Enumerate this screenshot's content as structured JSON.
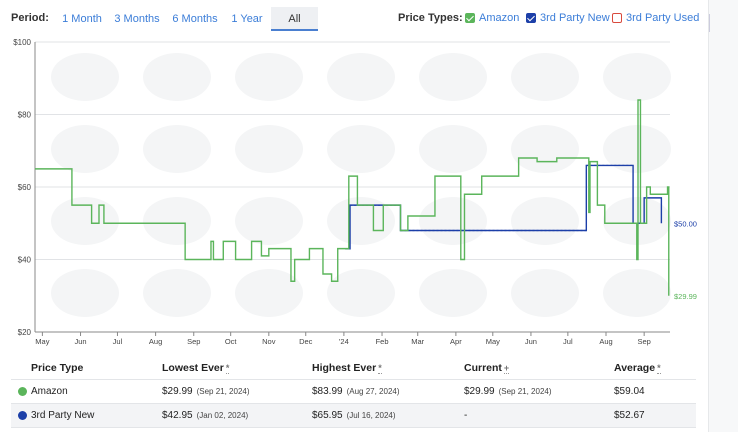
{
  "toolbar": {
    "period_label": "Period:",
    "periods": [
      "1 Month",
      "3 Months",
      "6 Months",
      "1 Year",
      "All"
    ],
    "active_period": "All",
    "price_types_label": "Price Types:",
    "price_types": [
      {
        "label": "Amazon",
        "color": "#5bb55b",
        "checked": true
      },
      {
        "label": "3rd Party New",
        "color": "#1c3fa8",
        "checked": true
      },
      {
        "label": "3rd Party Used",
        "color": "#d94a3d",
        "checked": false
      }
    ]
  },
  "chart_data": {
    "type": "line",
    "step": true,
    "x_ticks": [
      "May",
      "Jun",
      "Jul",
      "Aug",
      "Sep",
      "Oct",
      "Nov",
      "Dec",
      "'24",
      "Feb",
      "Mar",
      "Apr",
      "May",
      "Jun",
      "Jul",
      "Aug",
      "Sep"
    ],
    "y_ticks": [
      "$100",
      "$80",
      "$60",
      "$40",
      "$20"
    ],
    "ylim": [
      20,
      100
    ],
    "x_range": [
      "2023-04-25",
      "2024-09-22"
    ],
    "grid": true,
    "series": [
      {
        "name": "Amazon",
        "color": "#5bb55b",
        "points": [
          [
            "2023-04-25",
            65
          ],
          [
            "2023-05-25",
            55
          ],
          [
            "2023-06-10",
            50
          ],
          [
            "2023-06-16",
            55
          ],
          [
            "2023-06-20",
            50
          ],
          [
            "2023-08-25",
            40
          ],
          [
            "2023-09-15",
            45
          ],
          [
            "2023-09-17",
            40
          ],
          [
            "2023-09-25",
            45
          ],
          [
            "2023-10-05",
            40
          ],
          [
            "2023-10-18",
            45
          ],
          [
            "2023-10-26",
            41
          ],
          [
            "2023-11-01",
            43
          ],
          [
            "2023-11-19",
            34
          ],
          [
            "2023-11-22",
            40
          ],
          [
            "2023-12-04",
            43
          ],
          [
            "2023-12-15",
            36
          ],
          [
            "2023-12-22",
            34
          ],
          [
            "2023-12-27",
            43
          ],
          [
            "2024-01-05",
            63
          ],
          [
            "2024-01-12",
            55
          ],
          [
            "2024-01-25",
            48
          ],
          [
            "2024-02-02",
            55
          ],
          [
            "2024-02-16",
            48
          ],
          [
            "2024-02-22",
            52
          ],
          [
            "2024-03-15",
            63
          ],
          [
            "2024-04-05",
            40
          ],
          [
            "2024-04-08",
            58
          ],
          [
            "2024-04-22",
            63
          ],
          [
            "2024-05-22",
            68
          ],
          [
            "2024-06-06",
            67
          ],
          [
            "2024-06-22",
            68
          ],
          [
            "2024-07-18",
            53
          ],
          [
            "2024-07-19",
            67
          ],
          [
            "2024-07-25",
            55
          ],
          [
            "2024-07-31",
            50
          ],
          [
            "2024-08-26",
            40
          ],
          [
            "2024-08-27",
            84
          ],
          [
            "2024-08-29",
            50
          ],
          [
            "2024-09-03",
            60
          ],
          [
            "2024-09-06",
            58
          ],
          [
            "2024-09-20",
            60
          ],
          [
            "2024-09-21",
            29.99
          ]
        ]
      },
      {
        "name": "3rd Party New",
        "color": "#1c3fa8",
        "points": [
          [
            "2024-01-02",
            42.95
          ],
          [
            "2024-01-06",
            55
          ],
          [
            "2024-02-16",
            48
          ],
          [
            "2024-07-16",
            65.95
          ],
          [
            "2024-08-23",
            50
          ],
          [
            "2024-09-01",
            57
          ],
          [
            "2024-09-15",
            50
          ]
        ]
      }
    ],
    "end_labels": [
      {
        "series": "3rd Party New",
        "value": 50.0,
        "text": "$50.00"
      },
      {
        "series": "Amazon",
        "value": 29.99,
        "text": "$29.99"
      }
    ]
  },
  "table": {
    "headers": [
      "Price Type",
      "Lowest Ever",
      "Highest Ever",
      "Current",
      "Average"
    ],
    "header_marks": [
      "",
      "*",
      "*",
      "+",
      "*"
    ],
    "rows": [
      {
        "name": "Amazon",
        "color": "#5bb55b",
        "lowest": "$29.99",
        "lowest_date": "(Sep 21, 2024)",
        "highest": "$83.99",
        "highest_date": "(Aug 27, 2024)",
        "current": "$29.99",
        "current_date": "(Sep 21, 2024)",
        "average": "$59.04"
      },
      {
        "name": "3rd Party New",
        "color": "#1c3fa8",
        "lowest": "$42.95",
        "lowest_date": "(Jan 02, 2024)",
        "highest": "$65.95",
        "highest_date": "(Jul 16, 2024)",
        "current": "-",
        "current_date": "",
        "average": "$52.67"
      }
    ]
  }
}
